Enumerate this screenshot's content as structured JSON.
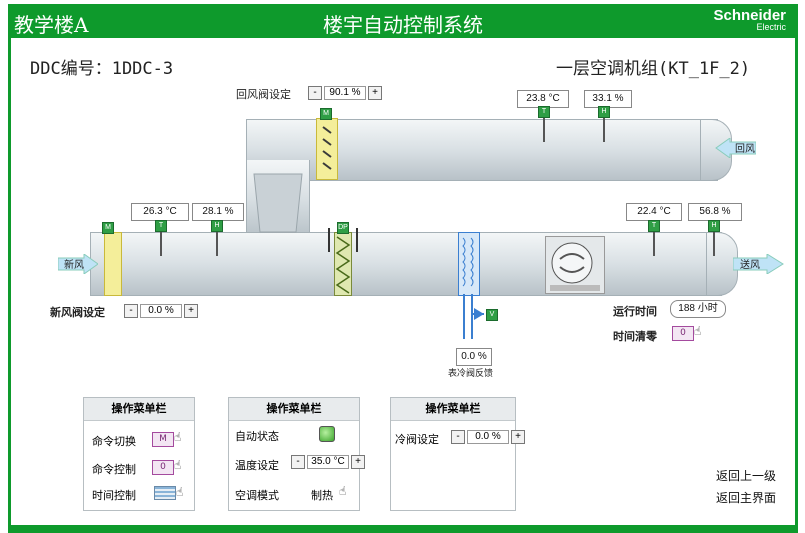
{
  "header": {
    "building": "教学楼A",
    "system_title": "楼宇自动控制系统",
    "logo_line1": "Schneider",
    "logo_line2": "Electric"
  },
  "ddc": "DDC编号：1DDC-3",
  "unit_title": "一层空调机组(KT_1F_2)",
  "return_damper": {
    "label": "回风阀设定",
    "value": "90.1 %"
  },
  "fresh_damper": {
    "label": "新风阀设定",
    "value": "0.0 %"
  },
  "sensors": {
    "return_temp": "23.8 °C",
    "return_hum": "33.1 %",
    "mix_temp": "26.3 °C",
    "mix_hum": "28.1 %",
    "supply_temp": "22.4 °C",
    "supply_hum": "56.8 %"
  },
  "sensor_marks": {
    "temp": "T",
    "hum": "H",
    "damper": "M",
    "filter": "DP"
  },
  "air_labels": {
    "fresh": "新风",
    "return": "回风",
    "supply": "送风"
  },
  "valve": {
    "feedback_value": "0.0 %",
    "feedback_label": "表冷阀反馈",
    "mark": "V"
  },
  "run_time": {
    "label": "运行时间",
    "value": "188 小时"
  },
  "time_reset": {
    "label": "时间清零",
    "button": "0"
  },
  "panels": [
    {
      "title": "操作菜单栏",
      "rows": [
        {
          "label": "命令切换",
          "button": "M"
        },
        {
          "label": "命令控制",
          "button": "0"
        },
        {
          "label": "时间控制"
        }
      ]
    },
    {
      "title": "操作菜单栏",
      "auto_label": "自动状态",
      "temp_label": "温度设定",
      "temp_value": "35.0 °C",
      "mode_label": "空调模式",
      "mode_value": "制热"
    },
    {
      "title": "操作菜单栏",
      "valve_label": "冷阀设定",
      "valve_value": "0.0 %"
    }
  ],
  "nav": {
    "back_up": "返回上一级",
    "back_main": "返回主界面"
  },
  "spinner": {
    "minus": "-",
    "plus": "+"
  },
  "colors": {
    "brand_green": "#0e9a2c",
    "sensor_green": "#2f9e45",
    "duct": "#d9e0e4",
    "coil_blue": "#3b7fd0",
    "damper_yellow": "#e2d24a"
  }
}
